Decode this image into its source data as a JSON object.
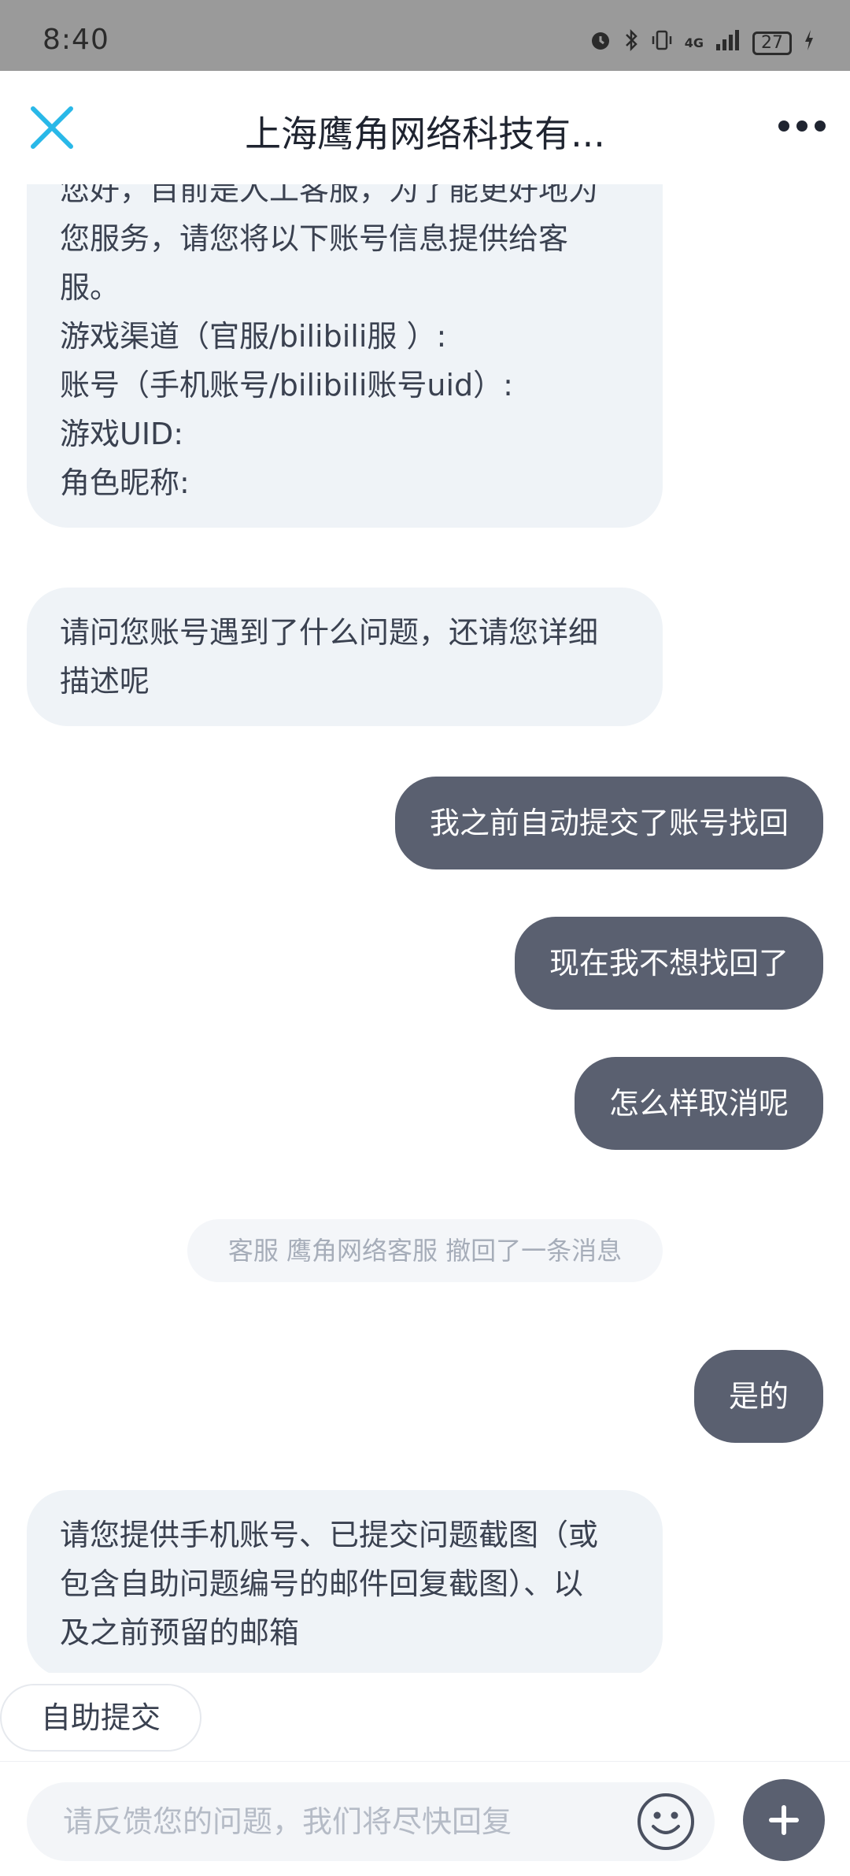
{
  "status_bar": {
    "time": "8:40",
    "network": "4G",
    "battery": "27"
  },
  "header": {
    "title": "上海鹰角网络科技有...",
    "close_icon": "close-icon",
    "more_icon": "more-icon"
  },
  "messages": [
    {
      "side": "left",
      "lines": [
        "您好，目前是人工客服，为了能更好地为",
        "您服务，请您将以下账号信息提供给客",
        "服。",
        "游戏渠道（官服/bilibili服 ）:",
        "账号（手机账号/bilibili账号uid）:",
        "游戏UID:",
        "角色昵称:"
      ]
    },
    {
      "side": "left",
      "lines": [
        "请问您账号遇到了什么问题，还请您详细",
        "描述呢"
      ]
    },
    {
      "side": "right",
      "text": "我之前自动提交了账号找回"
    },
    {
      "side": "right",
      "text": "现在我不想找回了"
    },
    {
      "side": "right",
      "text": "怎么样取消呢"
    },
    {
      "side": "right",
      "text": "是的"
    },
    {
      "side": "left",
      "lines": [
        "请您提供手机账号、已提交问题截图（或",
        "包含自助问题编号的邮件回复截图）、以",
        "及之前预留的邮箱"
      ]
    }
  ],
  "notice": "客服 鹰角网络客服 撤回了一条消息",
  "quick_actions": [
    "自助提交"
  ],
  "input": {
    "placeholder": "请反馈您的问题，我们将尽快回复",
    "value": ""
  },
  "colors": {
    "accent": "#29b8e8",
    "user_bubble": "#5a6070",
    "agent_bubble": "#eff3f7"
  }
}
